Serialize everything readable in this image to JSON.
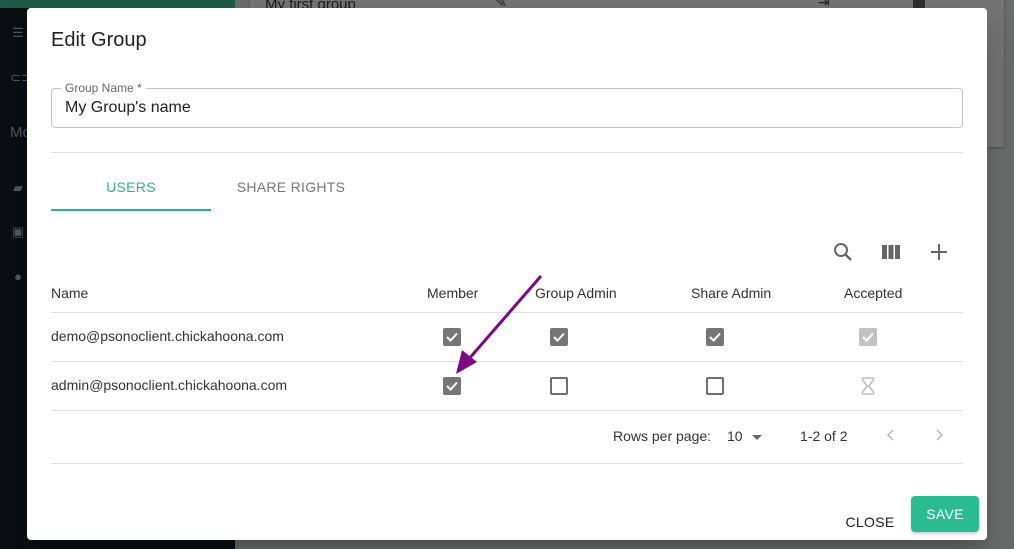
{
  "background": {
    "sidebar": {
      "icons": [
        "checklist-icon",
        "link-icon",
        "book-icon",
        "lock-icon",
        "info-icon"
      ],
      "partial_text": "Mo"
    },
    "card": {
      "row_text": "My first group"
    }
  },
  "dialog": {
    "title": "Edit Group",
    "group_name_field": {
      "label": "Group Name *",
      "value": "My Group's name"
    },
    "tabs": [
      {
        "label": "USERS",
        "active": true
      },
      {
        "label": "SHARE RIGHTS",
        "active": false
      }
    ],
    "toolbar": {
      "icons": [
        "search-icon",
        "columns-icon",
        "add-icon"
      ]
    },
    "table": {
      "columns": [
        "Name",
        "Member",
        "Group Admin",
        "Share Admin",
        "Accepted"
      ],
      "rows": [
        {
          "name": "demo@psonoclient.chickahoona.com",
          "member": true,
          "group_admin": true,
          "share_admin": true,
          "accepted": "accepted"
        },
        {
          "name": "admin@psonoclient.chickahoona.com",
          "member": true,
          "group_admin": false,
          "share_admin": false,
          "accepted": "pending"
        }
      ]
    },
    "pagination": {
      "rows_per_page_label": "Rows per page:",
      "rows_per_page_value": "10",
      "range_label": "1-2 of 2"
    },
    "actions": {
      "close_label": "CLOSE",
      "save_label": "SAVE"
    }
  },
  "colors": {
    "accent": "#2bb38e",
    "save_button": "#2bbb91",
    "annotation_arrow": "#7b0a87"
  },
  "annotation": {
    "type": "arrow",
    "target": "admin member checkbox"
  }
}
